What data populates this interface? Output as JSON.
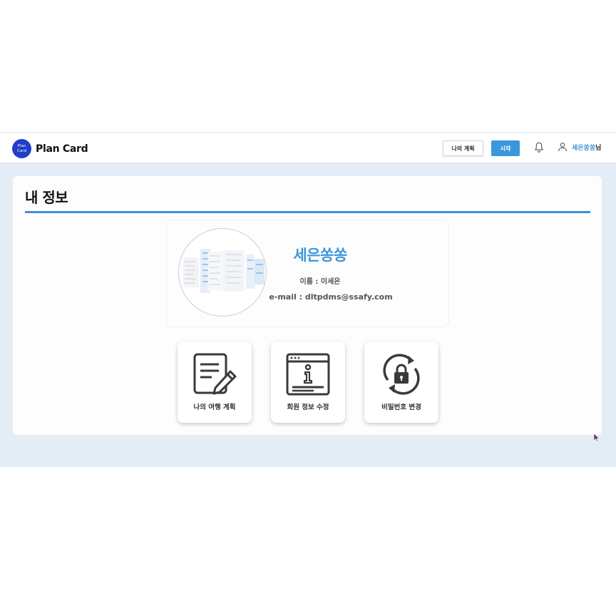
{
  "header": {
    "logo_circle_line1": "Plan",
    "logo_circle_line2": "Card",
    "logo_text": "Plan Card",
    "my_plan_button": "나의 계획",
    "start_button": "시작",
    "bell_icon": "bell-icon",
    "user_icon": "user-icon",
    "user_name": "세은쏭쏭",
    "user_suffix": "님"
  },
  "page": {
    "title": "내 정보"
  },
  "profile": {
    "nickname": "세은쏭쏭",
    "name_line": "이름 : 이세은",
    "email_line": "e-mail : dltpdms@ssafy.com"
  },
  "tiles": [
    {
      "label": "나의 여행 계획",
      "icon": "document-edit-icon"
    },
    {
      "label": "회원 정보 수정",
      "icon": "info-window-icon"
    },
    {
      "label": "비밀번호 변경",
      "icon": "lock-refresh-icon"
    }
  ],
  "colors": {
    "accent": "#3b97dd",
    "logo": "#1f3fc8",
    "background": "#e3edf5"
  }
}
